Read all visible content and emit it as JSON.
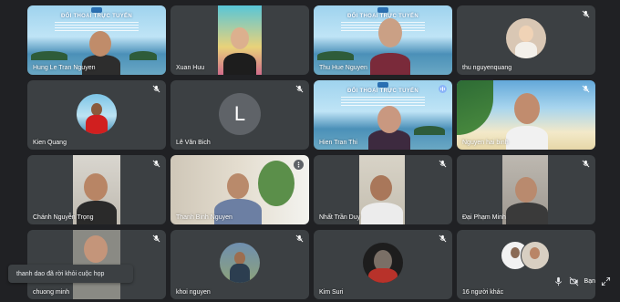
{
  "banner": {
    "title": "ĐỐI THOẠI TRỰC TUYẾN"
  },
  "participants": [
    {
      "name": "Hung Le Tran Nguyen"
    },
    {
      "name": "Xuan Huu"
    },
    {
      "name": "Thu Hue Nguyen"
    },
    {
      "name": "thu nguyenquang"
    },
    {
      "name": "Kien Quang"
    },
    {
      "name": "Lê Văn Bich",
      "initial": "L"
    },
    {
      "name": "Hien Tran Thi"
    },
    {
      "name": "Nguyen hai binh"
    },
    {
      "name": "Chánh Nguyễn Trọng"
    },
    {
      "name": "Thanh Binh Nguyen"
    },
    {
      "name": "Nhất Trần Duy"
    },
    {
      "name": "Đại Phạm Minh"
    },
    {
      "name": "chuong minh"
    },
    {
      "name": "khoi nguyen"
    },
    {
      "name": "Kim Suri"
    }
  ],
  "others_tile": {
    "label": "16 người khác"
  },
  "toast": {
    "text": "thanh dao đã rời khỏi cuộc họp"
  },
  "controls": {
    "you_label": "Bạn"
  },
  "colors": {
    "tile_bg": "#3c4043",
    "page_bg": "#202124",
    "speaking": "#8ab4f8"
  }
}
